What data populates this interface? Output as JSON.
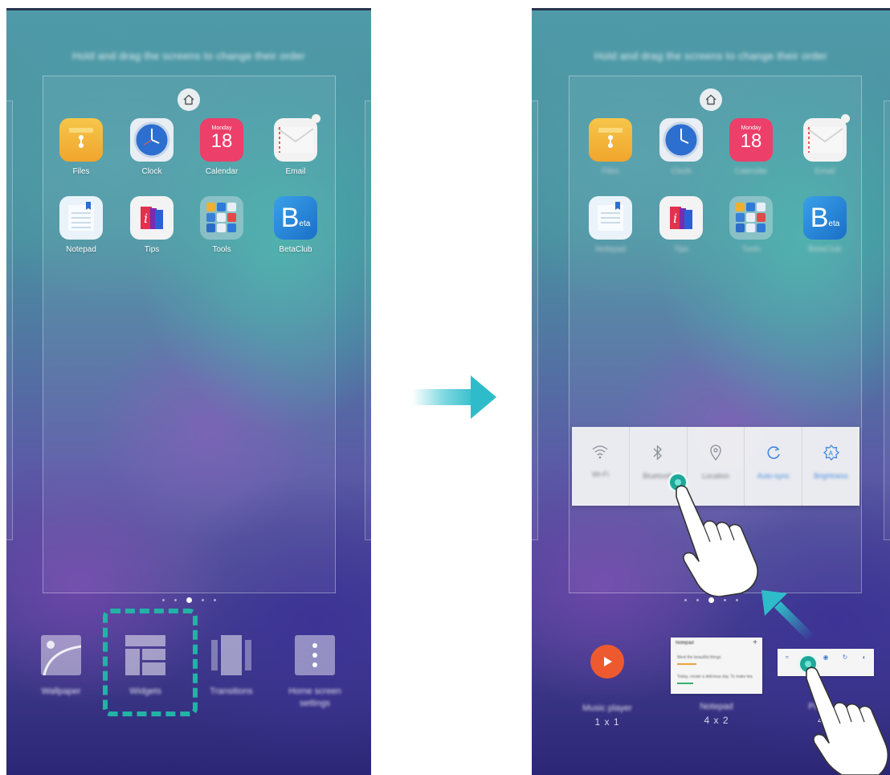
{
  "left_screen": {
    "hint": "Hold and drag the screens to change their order",
    "apps": [
      {
        "label": "Files",
        "icon": "files-icon"
      },
      {
        "label": "Clock",
        "icon": "clock-icon"
      },
      {
        "label": "Calendar",
        "icon": "calendar-icon",
        "day_name": "Monday",
        "day_number": "18"
      },
      {
        "label": "Email",
        "icon": "email-icon"
      },
      {
        "label": "Notepad",
        "icon": "notepad-icon"
      },
      {
        "label": "Tips",
        "icon": "tips-icon"
      },
      {
        "label": "Tools",
        "icon": "tools-folder-icon"
      },
      {
        "label": "BetaClub",
        "icon": "betaclub-icon"
      }
    ],
    "bottom_menu": [
      {
        "label": "Wallpaper",
        "icon": "wallpaper-icon"
      },
      {
        "label": "Widgets",
        "icon": "widgets-icon"
      },
      {
        "label": "Transitions",
        "icon": "transitions-icon"
      },
      {
        "label": "Home screen settings",
        "icon": "more-vertical-icon"
      }
    ],
    "page_indicator": {
      "count": 5,
      "active": 2
    }
  },
  "right_screen": {
    "hint": "Hold and drag the screens to change their order",
    "apps": [
      {
        "label": "Files"
      },
      {
        "label": "Clock"
      },
      {
        "label": "Calendar",
        "day_name": "Monday",
        "day_number": "18"
      },
      {
        "label": "Email"
      },
      {
        "label": "Notepad"
      },
      {
        "label": "Tips"
      },
      {
        "label": "Tools"
      },
      {
        "label": "BetaClub"
      }
    ],
    "quick_settings_widget": [
      {
        "label": "Wi-Fi",
        "icon": "wifi-icon"
      },
      {
        "label": "Bluetooth",
        "icon": "bluetooth-icon"
      },
      {
        "label": "Location",
        "icon": "location-icon"
      },
      {
        "label": "Auto-sync",
        "icon": "sync-icon"
      },
      {
        "label": "Brightness",
        "icon": "brightness-icon"
      }
    ],
    "widgets_tray": [
      {
        "name": "Music player",
        "size": "1 x 1"
      },
      {
        "name": "Notepad",
        "size": "4 x 2",
        "preview_title": "Notepad",
        "preview_line1": "Meet the beautiful things",
        "preview_line2": "Today, create a delicious day. To make tea"
      },
      {
        "name": "Power",
        "size": "4"
      }
    ],
    "page_indicator": {
      "count": 5,
      "active": 2
    }
  },
  "colors": {
    "accent": "#22b3a6",
    "arrow": "#2fbcca",
    "music": "#ee5a2f"
  }
}
